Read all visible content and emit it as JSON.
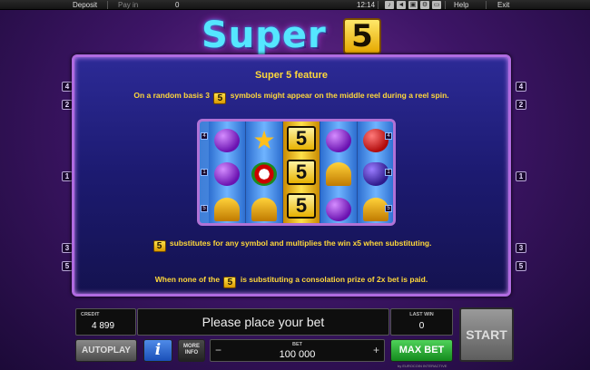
{
  "top_bar": {
    "deposit": "Deposit",
    "payin_label": "Pay in",
    "payin_value": "0",
    "time": "12:14",
    "help": "Help",
    "exit": "Exit"
  },
  "logo": {
    "word": "Super",
    "number": "5"
  },
  "side_markers": {
    "left": [
      "4",
      "2",
      "1",
      "3",
      "5"
    ],
    "right": [
      "4",
      "2",
      "1",
      "3",
      "5"
    ]
  },
  "panel": {
    "title": "Super 5 feature",
    "line1_before": "On a random basis 3",
    "line1_after": "symbols might appear on the middle reel during a reel spin.",
    "line2_after": "substitutes for any symbol and multiplies the win x5 when substituting.",
    "line3_before": "When none of the",
    "line3_after": "is substituting a consolation prize of 2x bet is paid.",
    "chip_label": "5"
  },
  "reels": {
    "columns": [
      [
        "plum",
        "plum",
        "bell"
      ],
      [
        "star",
        "melon",
        "bell"
      ],
      [
        "five",
        "five",
        "five"
      ],
      [
        "plum",
        "bell",
        "plum"
      ],
      [
        "cherry",
        "grape",
        "bell"
      ]
    ],
    "five_label": "5",
    "star_glyph": "★",
    "left_numbers": [
      "4",
      "1",
      "5"
    ],
    "right_numbers": [
      "4",
      "1",
      "5"
    ]
  },
  "credit": {
    "label": "CREDIT",
    "value": "4 899"
  },
  "message": "Please place your bet",
  "last_win": {
    "label": "LAST WIN",
    "value": "0"
  },
  "buttons": {
    "autoplay": "AUTOPLAY",
    "info": "i",
    "more_info": "MORE INFO",
    "max_bet": "MAX BET",
    "start": "START"
  },
  "bet": {
    "label": "BET",
    "value": "100 000",
    "minus": "−",
    "plus": "+"
  },
  "footer": "by EUROCOIN INTERACTIVE"
}
